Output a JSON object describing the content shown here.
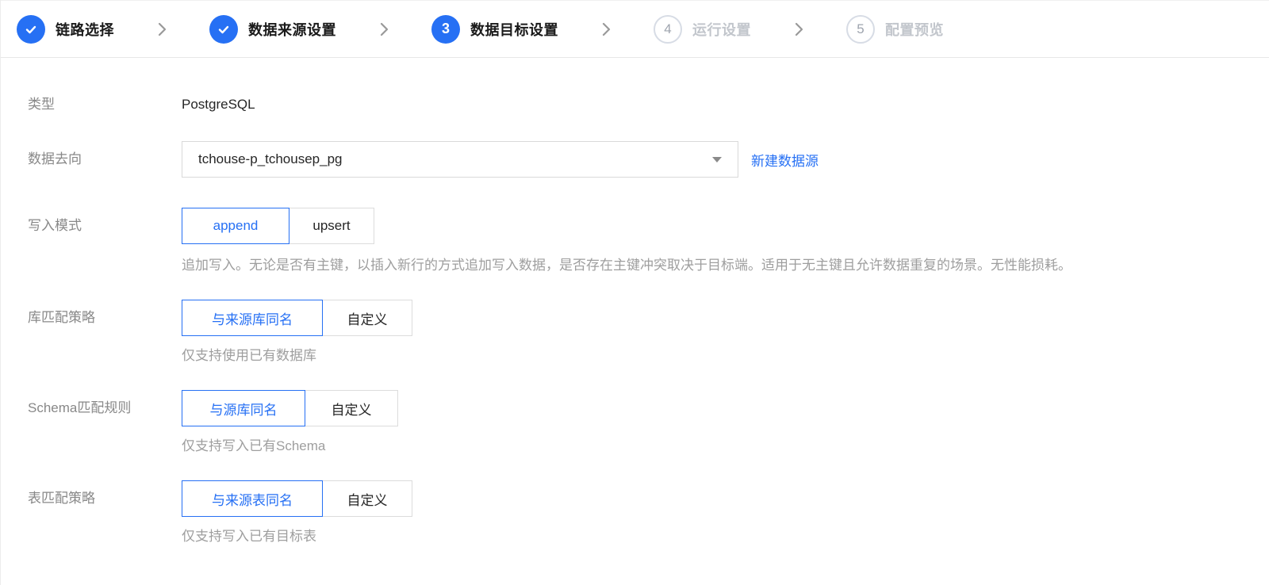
{
  "colors": {
    "accent": "#2670F4",
    "step_inactive_border": "#D7DCE5",
    "label_gray": "#888888",
    "hint_gray": "#9E9E9E",
    "divider": "#E7E7E7"
  },
  "steps": {
    "items": [
      {
        "label": "链路选择",
        "state": "done",
        "icon": "check-icon"
      },
      {
        "label": "数据来源设置",
        "state": "done",
        "icon": "check-icon"
      },
      {
        "number": "3",
        "label": "数据目标设置",
        "state": "current"
      },
      {
        "number": "4",
        "label": "运行设置",
        "state": "pending"
      },
      {
        "number": "5",
        "label": "配置预览",
        "state": "pending"
      }
    ]
  },
  "form": {
    "type": {
      "label": "类型",
      "value": "PostgreSQL"
    },
    "target": {
      "label": "数据去向",
      "selected_value": "tchouse-p_tchousep_pg",
      "create_link": "新建数据源"
    },
    "write_mode": {
      "label": "写入模式",
      "options": [
        "append",
        "upsert"
      ],
      "selected": "append",
      "description": "追加写入。无论是否有主键，以插入新行的方式追加写入数据，是否存在主键冲突取决于目标端。适用于无主键且允许数据重复的场景。无性能损耗。"
    },
    "db_match": {
      "label": "库匹配策略",
      "options": [
        "与来源库同名",
        "自定义"
      ],
      "selected": "与来源库同名",
      "hint": "仅支持使用已有数据库"
    },
    "schema_match": {
      "label": "Schema匹配规则",
      "options": [
        "与源库同名",
        "自定义"
      ],
      "selected": "与源库同名",
      "hint": "仅支持写入已有Schema"
    },
    "table_match": {
      "label": "表匹配策略",
      "options": [
        "与来源表同名",
        "自定义"
      ],
      "selected": "与来源表同名",
      "hint": "仅支持写入已有目标表"
    }
  }
}
